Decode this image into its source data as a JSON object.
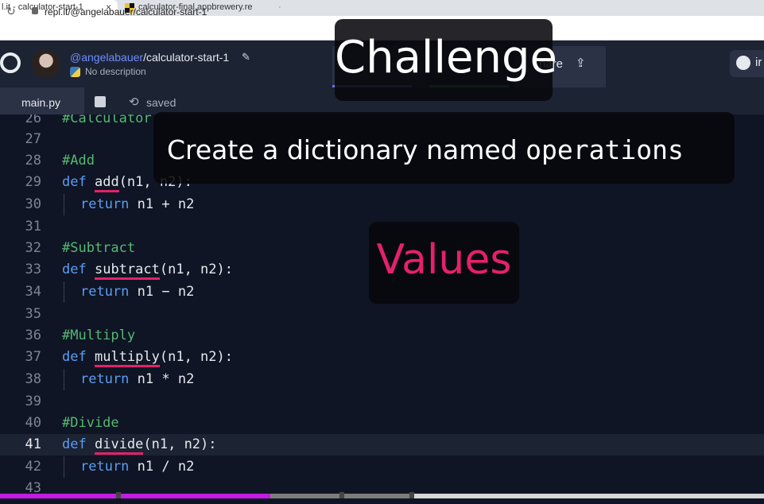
{
  "browser": {
    "tabs": [
      {
        "label": "l.it - calculator-start-1",
        "close": "×"
      },
      {
        "label": "calculator-final.appbrewery.re"
      },
      {
        "label": "·"
      }
    ],
    "url": "repl.it/@angelabauer/calculator-start-1",
    "reload_icon": "↻"
  },
  "header": {
    "user": "@angelabauer",
    "repl_name": "/calculator-start-1",
    "edit_icon": "✎",
    "description": "No description",
    "share_label": "hare",
    "share_icon": "⇪",
    "github_letter": "ir"
  },
  "editor_tabs": {
    "file": "main.py",
    "saved_icon": "⟲",
    "saved_label": "saved"
  },
  "code": {
    "l26": {
      "n": "26",
      "text": "#Calculator"
    },
    "l27": {
      "n": "27"
    },
    "l28": {
      "n": "28",
      "text": "#Add"
    },
    "l29": {
      "n": "29",
      "kw": "def",
      "fn": "add",
      "rest": "(n1, n2):"
    },
    "l30": {
      "n": "30",
      "kw": "return",
      "rest": " n1 + n2"
    },
    "l31": {
      "n": "31"
    },
    "l32": {
      "n": "32",
      "text": "#Subtract"
    },
    "l33": {
      "n": "33",
      "kw": "def",
      "fn": "subtract",
      "rest": "(n1, n2):"
    },
    "l34": {
      "n": "34",
      "kw": "return",
      "rest": " n1 − n2"
    },
    "l35": {
      "n": "35"
    },
    "l36": {
      "n": "36",
      "text": "#Multiply"
    },
    "l37": {
      "n": "37",
      "kw": "def",
      "fn": "multiply",
      "rest": "(n1, n2):"
    },
    "l38": {
      "n": "38",
      "kw": "return",
      "rest": " n1 * n2"
    },
    "l39": {
      "n": "39"
    },
    "l40": {
      "n": "40",
      "text": "#Divide"
    },
    "l41": {
      "n": "41",
      "kw": "def",
      "fn": "divide",
      "rest": "(n1, n2):"
    },
    "l42": {
      "n": "42",
      "kw": "return",
      "rest": " n1 / n2"
    },
    "l43": {
      "n": "43"
    }
  },
  "overlays": {
    "challenge": "Challenge",
    "instruction_prefix": "Create a dictionary named",
    "instruction_code": "operations",
    "values": "Values"
  },
  "video_progress": 0.354,
  "colors": {
    "accent_pink": "#e5216b",
    "keyword": "#5c9cf5",
    "comment": "#56b871",
    "progress": "#c31be3"
  }
}
